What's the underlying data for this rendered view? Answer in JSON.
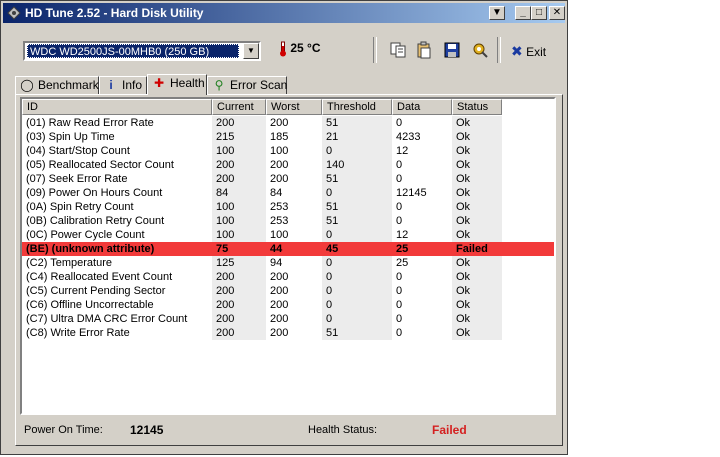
{
  "window": {
    "title": "HD Tune 2.52 - Hard Disk Utility"
  },
  "toolbar": {
    "drive_selected": "WDC WD2500JS-00MHB0 (250 GB)",
    "temperature": "25 °C",
    "exit_label": "Exit"
  },
  "tabs": [
    {
      "label": "Benchmark",
      "icon": "benchmark-icon"
    },
    {
      "label": "Info",
      "icon": "info-icon"
    },
    {
      "label": "Health",
      "icon": "health-cross-icon",
      "active": true
    },
    {
      "label": "Error Scan",
      "icon": "magnifier-icon"
    }
  ],
  "table": {
    "columns": [
      "ID",
      "Current",
      "Worst",
      "Threshold",
      "Data",
      "Status"
    ],
    "rows": [
      {
        "id": "(01) Raw Read Error Rate",
        "current": "200",
        "worst": "200",
        "threshold": "51",
        "data": "0",
        "status": "Ok"
      },
      {
        "id": "(03) Spin Up Time",
        "current": "215",
        "worst": "185",
        "threshold": "21",
        "data": "4233",
        "status": "Ok"
      },
      {
        "id": "(04) Start/Stop Count",
        "current": "100",
        "worst": "100",
        "threshold": "0",
        "data": "12",
        "status": "Ok"
      },
      {
        "id": "(05) Reallocated Sector Count",
        "current": "200",
        "worst": "200",
        "threshold": "140",
        "data": "0",
        "status": "Ok"
      },
      {
        "id": "(07) Seek Error Rate",
        "current": "200",
        "worst": "200",
        "threshold": "51",
        "data": "0",
        "status": "Ok"
      },
      {
        "id": "(09) Power On Hours Count",
        "current": "84",
        "worst": "84",
        "threshold": "0",
        "data": "12145",
        "status": "Ok"
      },
      {
        "id": "(0A) Spin Retry Count",
        "current": "100",
        "worst": "253",
        "threshold": "51",
        "data": "0",
        "status": "Ok"
      },
      {
        "id": "(0B) Calibration Retry Count",
        "current": "100",
        "worst": "253",
        "threshold": "51",
        "data": "0",
        "status": "Ok"
      },
      {
        "id": "(0C) Power Cycle Count",
        "current": "100",
        "worst": "100",
        "threshold": "0",
        "data": "12",
        "status": "Ok"
      },
      {
        "id": "(BE) (unknown attribute)",
        "current": "75",
        "worst": "44",
        "threshold": "45",
        "data": "25",
        "status": "Failed",
        "failed": true
      },
      {
        "id": "(C2) Temperature",
        "current": "125",
        "worst": "94",
        "threshold": "0",
        "data": "25",
        "status": "Ok"
      },
      {
        "id": "(C4) Reallocated Event Count",
        "current": "200",
        "worst": "200",
        "threshold": "0",
        "data": "0",
        "status": "Ok"
      },
      {
        "id": "(C5) Current Pending Sector",
        "current": "200",
        "worst": "200",
        "threshold": "0",
        "data": "0",
        "status": "Ok"
      },
      {
        "id": "(C6) Offline Uncorrectable",
        "current": "200",
        "worst": "200",
        "threshold": "0",
        "data": "0",
        "status": "Ok"
      },
      {
        "id": "(C7) Ultra DMA CRC Error Count",
        "current": "200",
        "worst": "200",
        "threshold": "0",
        "data": "0",
        "status": "Ok"
      },
      {
        "id": "(C8) Write Error Rate",
        "current": "200",
        "worst": "200",
        "threshold": "51",
        "data": "0",
        "status": "Ok"
      }
    ]
  },
  "footer": {
    "power_on_label": "Power On Time:",
    "power_on_value": "12145",
    "health_label": "Health Status:",
    "health_value": "Failed"
  },
  "colors": {
    "failed_row": "#f23a3a",
    "failed_text": "#d42020",
    "titlebar_start": "#0a246a",
    "titlebar_end": "#a6caf0"
  }
}
